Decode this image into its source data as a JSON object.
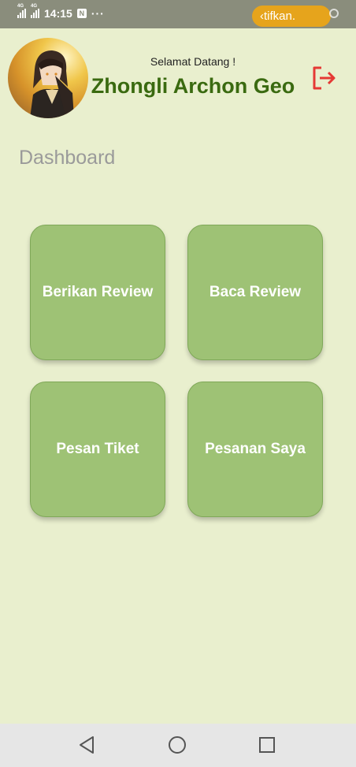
{
  "status_bar": {
    "network_1": "4G",
    "network_2": "4G",
    "time": "14:15",
    "more": "···",
    "notification_text": "‹tifkan."
  },
  "header": {
    "greeting": "Selamat Datang !",
    "user_name": "Zhongli Archon Geo",
    "avatar": "profile-avatar",
    "logout_icon": "logout-icon"
  },
  "page": {
    "title": "Dashboard"
  },
  "menu": {
    "items": [
      {
        "label": "Berikan Review"
      },
      {
        "label": "Baca Review"
      },
      {
        "label": "Pesan Tiket"
      },
      {
        "label": "Pesanan Saya"
      }
    ]
  },
  "nav_bar": {
    "back_icon": "back-triangle-icon",
    "home_icon": "home-circle-icon",
    "recent_icon": "recent-square-icon"
  },
  "colors": {
    "background": "#e9efce",
    "card": "#9ec275",
    "name": "#3a6a10",
    "logout": "#e53935",
    "status_bar": "#8a8d7c",
    "notification": "#e6a41c"
  }
}
